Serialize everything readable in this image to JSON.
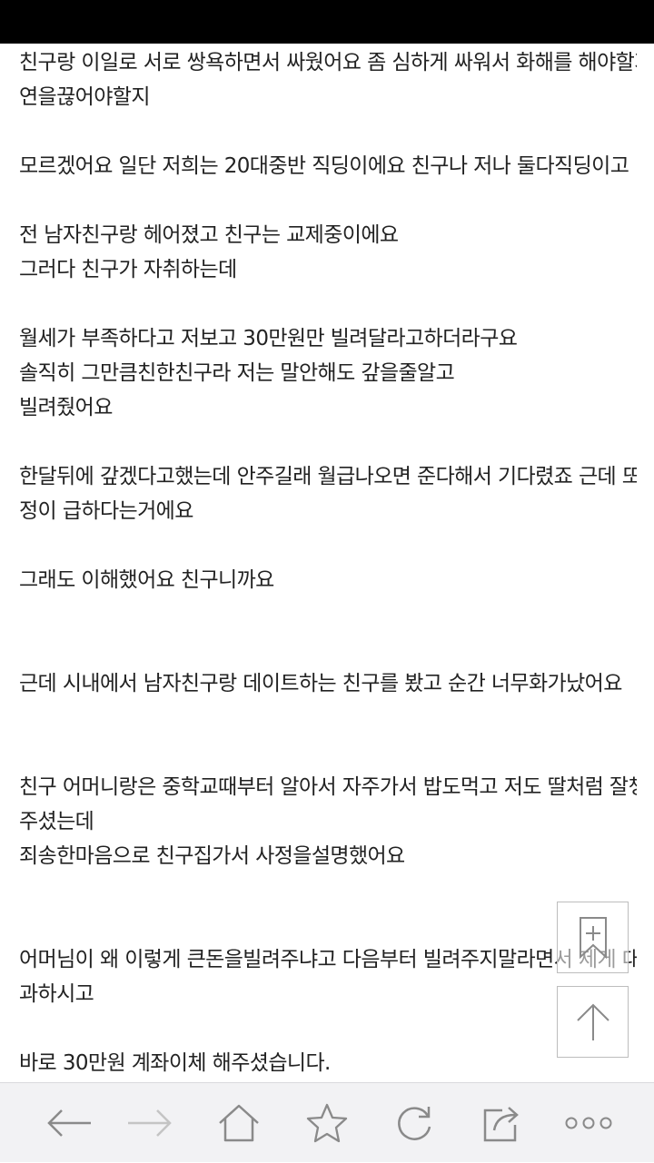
{
  "article": {
    "lines": [
      "친구랑 이일로 서로 쌍욕하면서 싸웠어요 좀 심하게 싸워서 화해를 해야할지 인",
      "연을끊어야할지",
      "모르겠어요 일단 저희는 20대중반 직딩이에요 친구나 저나 둘다직딩이고",
      "전 남자친구랑 헤어졌고 친구는 교제중이에요",
      "그러다 친구가 자취하는데",
      "월세가 부족하다고 저보고 30만원만 빌려달라고하더라구요",
      "솔직히 그만큼친한친구라 저는 말안해도 갚을줄알고",
      "빌려줬어요",
      "한달뒤에 갚겠다고했는데 안주길래 월급나오면 준다해서 기다렸죠 근데 또 사",
      "정이 급하다는거에요",
      "그래도 이해했어요 친구니까요",
      "근데 시내에서 남자친구랑 데이트하는 친구를 봤고 순간 너무화가났어요",
      "친구 어머니랑은 중학교때부터 알아서 자주가서 밥도먹고 저도 딸처럼 잘챙겨",
      "주셨는데",
      "죄송한마음으로 친구집가서 사정을설명했어요",
      "어머님이 왜 이렇게 큰돈을빌려주냐고 다음부터 빌려주지말라면서 제게 대신사",
      "과하시고",
      "바로 30만원 계좌이체 해주셨습니다."
    ]
  },
  "floating": {
    "bookmark_icon": "bookmark-add-icon",
    "scroll_top_icon": "arrow-up-icon"
  },
  "toolbar": {
    "icons": [
      "back-arrow-icon",
      "forward-arrow-icon",
      "home-icon",
      "star-icon",
      "refresh-icon",
      "share-icon",
      "more-icon"
    ]
  },
  "colors": {
    "text": "#222222",
    "toolbar_bg": "#f2f2f4",
    "icon": "#8a8a8a",
    "icon_disabled": "#c4c4c4",
    "status_bar": "#000000"
  }
}
